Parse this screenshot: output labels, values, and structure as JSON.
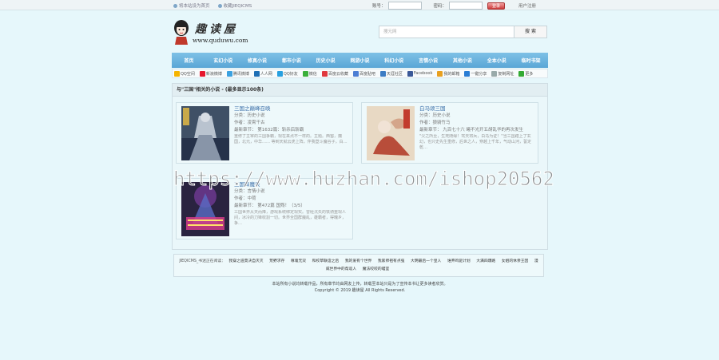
{
  "topbar": {
    "set_home": "将本站设为首页",
    "favorite": "收藏JIEQICMS",
    "account_label": "账号：",
    "password_label": "密码：",
    "login_button": "登录",
    "register": "用户注册"
  },
  "header": {
    "logo_text": "趣读屋",
    "logo_url": "www.quduwu.com",
    "search_placeholder": "搜元网",
    "search_button": "搜 索"
  },
  "nav": [
    "首页",
    "玄幻小说",
    "修真小说",
    "都市小说",
    "历史小说",
    "网游小说",
    "科幻小说",
    "言情小说",
    "其他小说",
    "全本小说",
    "临时书架"
  ],
  "share": [
    "QQ空间",
    "新浪微博",
    "腾讯微博",
    "人人网",
    "QQ好友",
    "微信",
    "百度云收藏",
    "百度贴吧",
    "天涯社区",
    "Facebook",
    "我的邮箱",
    "一键分享",
    "复制网址",
    "更多"
  ],
  "results": {
    "heading": "与\"三国\"相关的小说 - (最多显示100条)",
    "books": [
      {
        "title": "三国之巅峰召唤",
        "category": "分类：历史小说",
        "author": "作者：凌霄千古",
        "latest": "最新章节： 第1632篇：斩杀后斩霸",
        "intro": "重修了主宰的三国争霸，现在来点不一样的。主题。西蜀，魏国，北元，中华…… 等到天就云虎上阵，伴我登斗魔谷子，白…"
      },
      {
        "title": "白马颂三国",
        "category": "分类：历史小说",
        "author": "作者：狼骑竹马",
        "latest": "最新章节： 九百七十六 曦不光开五胡乱华的再次发生",
        "intro": "\"父之所至，生死随缘！驾天将兵，白马为证！\"当三国踏上了玄幻，也只史先生重修，后世之人，穿越上千年，气动山河，誓定乾…"
      },
      {
        "title": "三国降魔录",
        "category": "分类：言情小说",
        "author": "作者：中荷",
        "latest": "最新章节： 第472篇 国殇！（3/5）",
        "intro": "三国世界从天而降，游戏系统绑定现实。曾经沉失的铁骑重现人间，冰冷的刀锋收割一切。世界全国群魔乱，雄霸者，得魄乡，争…"
      }
    ]
  },
  "watermark": "https://www.huzhan.com/ishop20562",
  "reading": {
    "label": "JIEQICMS_书迷正在阅读：",
    "links": [
      "我穿之道莫决自灭灭",
      "荒野求存",
      "尊魂无双",
      "和校草联谊之后",
      "我的爱有个世界",
      "我家师祖有点强",
      "大明最后一个皇人",
      "谁弃鸡驱计划",
      "大满四爆路",
      "女姐的休亲王因",
      "漫威世界中的帮逗人",
      "魔法咬咬的喵室"
    ]
  },
  "footer": {
    "line1": "本站所有小说均转载作品，所有章节均由网友上传，转载至本站只是为了宣传本书让更多读者欣赏。",
    "line2": "Copyright © 2019 趣读屋 All Rights Reserved."
  },
  "colors": {
    "nav": "#6cb4e0",
    "background": "#e6f7fb",
    "title_link": "#3a6ea8"
  }
}
